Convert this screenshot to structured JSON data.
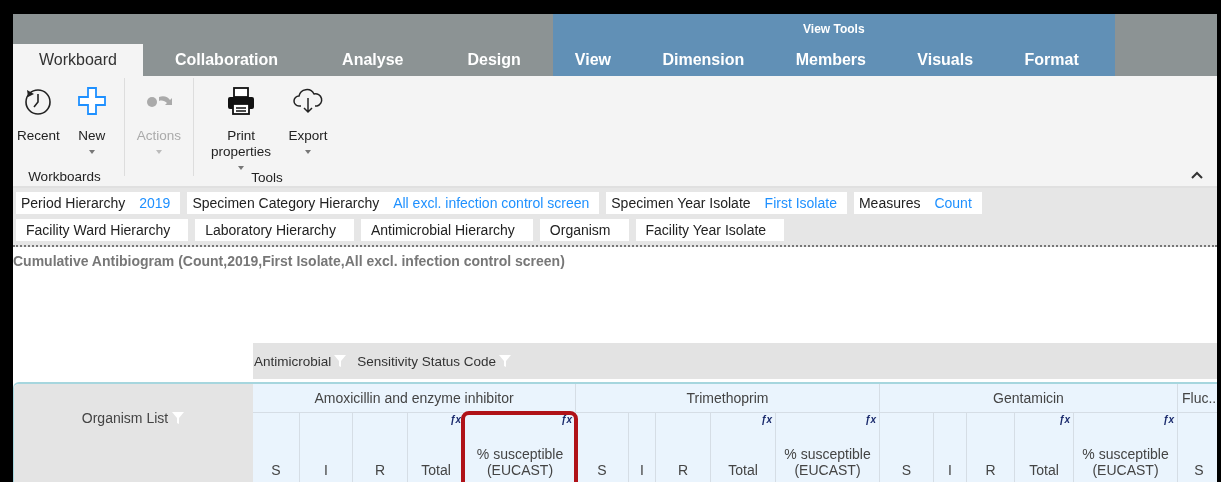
{
  "ribbon_tabs": [
    {
      "label": "Workboard",
      "selected": true,
      "kind": "standard"
    },
    {
      "label": "Collaboration",
      "selected": false,
      "kind": "standard"
    },
    {
      "label": "Analyse",
      "selected": false,
      "kind": "standard"
    },
    {
      "label": "Design",
      "selected": false,
      "kind": "standard"
    },
    {
      "label": "View",
      "selected": false,
      "kind": "contextual"
    },
    {
      "label": "Dimension",
      "selected": false,
      "kind": "contextual"
    },
    {
      "label": "Members",
      "selected": false,
      "kind": "contextual"
    },
    {
      "label": "Visuals",
      "selected": false,
      "kind": "contextual"
    },
    {
      "label": "Format",
      "selected": false,
      "kind": "contextual"
    }
  ],
  "contextual_group": {
    "label": "View Tools"
  },
  "ribbon_groups": [
    {
      "label": "Workboards",
      "buttons": [
        {
          "label": "Recent",
          "dropdown": false,
          "disabled": false
        },
        {
          "label": "New",
          "dropdown": true,
          "disabled": false
        }
      ]
    },
    {
      "buttons": [
        {
          "label": "Actions",
          "dropdown": true,
          "disabled": true
        }
      ]
    },
    {
      "label": "Tools",
      "buttons": [
        {
          "label": "Print properties",
          "dropdown": true,
          "disabled": false
        },
        {
          "label": "Export",
          "dropdown": true,
          "disabled": false
        }
      ]
    }
  ],
  "filter_rows": [
    [
      {
        "label": "Period Hierarchy",
        "value": "2019"
      },
      {
        "label": "Specimen Category Hierarchy",
        "value": "All excl. infection control screen"
      },
      {
        "label": "Specimen Year Isolate",
        "value": "First Isolate"
      },
      {
        "label": "Measures",
        "value": "Count"
      }
    ],
    [
      {
        "label": "Facility Ward Hierarchy"
      },
      {
        "label": "Laboratory Hierarchy"
      },
      {
        "label": "Antimicrobial Hierarchy"
      },
      {
        "label": "Organism"
      },
      {
        "label": "Facility Year Isolate"
      }
    ]
  ],
  "report": {
    "title": "Cumulative Antibiogram (Count,2019,First Isolate,All excl. infection control screen)",
    "pivot_fields": [
      {
        "label": "Antimicrobial"
      },
      {
        "label": "Sensitivity Status Code"
      }
    ],
    "row_header": {
      "label": "Organism List"
    },
    "groups": [
      {
        "label": "Amoxicillin and enzyme inhibitor",
        "columns": [
          {
            "label": "S"
          },
          {
            "label": "I"
          },
          {
            "label": "R"
          },
          {
            "label": "Total",
            "formula": "ƒx"
          },
          {
            "label": "% susceptible (EUCAST)",
            "formula": "ƒx",
            "highlighted": true
          }
        ]
      },
      {
        "label": "Trimethoprim",
        "columns": [
          {
            "label": "S"
          },
          {
            "label": "I"
          },
          {
            "label": "R"
          },
          {
            "label": "Total",
            "formula": "ƒx"
          },
          {
            "label": "% susceptible (EUCAST)",
            "formula": "ƒx",
            "highlighted": false
          }
        ]
      },
      {
        "label": "Gentamicin",
        "columns": [
          {
            "label": "S"
          },
          {
            "label": "I"
          },
          {
            "label": "R"
          },
          {
            "label": "Total",
            "formula": "ƒx"
          },
          {
            "label": "% susceptible (EUCAST)",
            "formula": "ƒx",
            "highlighted": false
          }
        ]
      },
      {
        "label": "Fluc...",
        "columns": [
          {
            "label": "S"
          }
        ]
      }
    ]
  }
}
